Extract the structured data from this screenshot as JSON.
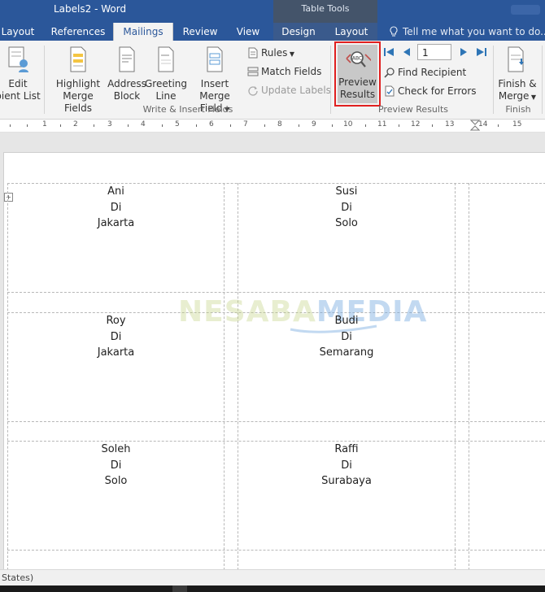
{
  "window": {
    "title": "Labels2 - Word"
  },
  "contextual": {
    "label": "Table Tools"
  },
  "tabs": [
    {
      "label": "Layout"
    },
    {
      "label": "References"
    },
    {
      "label": "Mailings"
    },
    {
      "label": "Review"
    },
    {
      "label": "View"
    },
    {
      "label": "Design"
    },
    {
      "label": "Layout"
    }
  ],
  "tell_me": {
    "placeholder": "Tell me what you want to do..."
  },
  "ribbon": {
    "edit_recipient": {
      "line1": "Edit",
      "line2": "pient List"
    },
    "highlight": {
      "line1": "Highlight",
      "line2": "Merge Fields"
    },
    "address": {
      "line1": "Address",
      "line2": "Block"
    },
    "greeting": {
      "line1": "Greeting",
      "line2": "Line"
    },
    "insert_merge": {
      "line1": "Insert Merge",
      "line2": "Field"
    },
    "rules": "Rules",
    "match_fields": "Match Fields",
    "update_labels": "Update Labels",
    "write_insert_group": "Write & Insert Fields",
    "preview": {
      "line1": "Preview",
      "line2": "Results"
    },
    "record_number": "1",
    "find_recipient": "Find Recipient",
    "check_errors": "Check for Errors",
    "preview_group": "Preview Results",
    "finish": {
      "line1": "Finish &",
      "line2": "Merge"
    },
    "finish_group": "Finish"
  },
  "ruler": {
    "numbers": [
      "1",
      "2",
      "3",
      "4",
      "5",
      "6",
      "7",
      "8",
      "9",
      "10",
      "11",
      "12",
      "13",
      "14",
      "15"
    ]
  },
  "labels": [
    {
      "name": "Ani",
      "di": "Di",
      "city": "Jakarta"
    },
    {
      "name": "Susi",
      "di": "Di",
      "city": "Solo"
    },
    {
      "name": "Roy",
      "di": "Di",
      "city": "Jakarta"
    },
    {
      "name": "Budi",
      "di": "Di",
      "city": "Semarang"
    },
    {
      "name": "Soleh",
      "di": "Di",
      "city": "Solo"
    },
    {
      "name": "Raffi",
      "di": "Di",
      "city": "Surabaya"
    }
  ],
  "watermark": {
    "part1": "NESABA",
    "part2": "MEDIA"
  },
  "status": {
    "text": "States)"
  }
}
